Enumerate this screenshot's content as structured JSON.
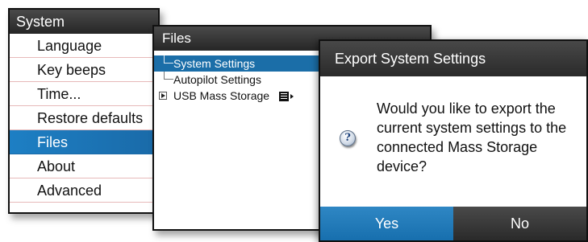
{
  "system_menu": {
    "title": "System",
    "items": [
      {
        "label": "Language",
        "selected": false
      },
      {
        "label": "Key beeps",
        "selected": false
      },
      {
        "label": "Time...",
        "selected": false
      },
      {
        "label": "Restore defaults",
        "selected": false
      },
      {
        "label": "Files",
        "selected": true
      },
      {
        "label": "About",
        "selected": false
      },
      {
        "label": "Advanced",
        "selected": false
      }
    ]
  },
  "files_panel": {
    "title": "Files",
    "tree": {
      "system_settings": "System Settings",
      "autopilot_settings": "Autopilot Settings",
      "usb_storage": "USB Mass Storage"
    },
    "selected": "System Settings"
  },
  "export_dialog": {
    "title": "Export System Settings",
    "message": "Would you like to export the current system settings to the connected Mass Storage device?",
    "icon": "question-icon",
    "yes_label": "Yes",
    "no_label": "No"
  },
  "colors": {
    "selection_blue": "#1b6ea8",
    "title_bar_dark": "#2a2a2a"
  }
}
